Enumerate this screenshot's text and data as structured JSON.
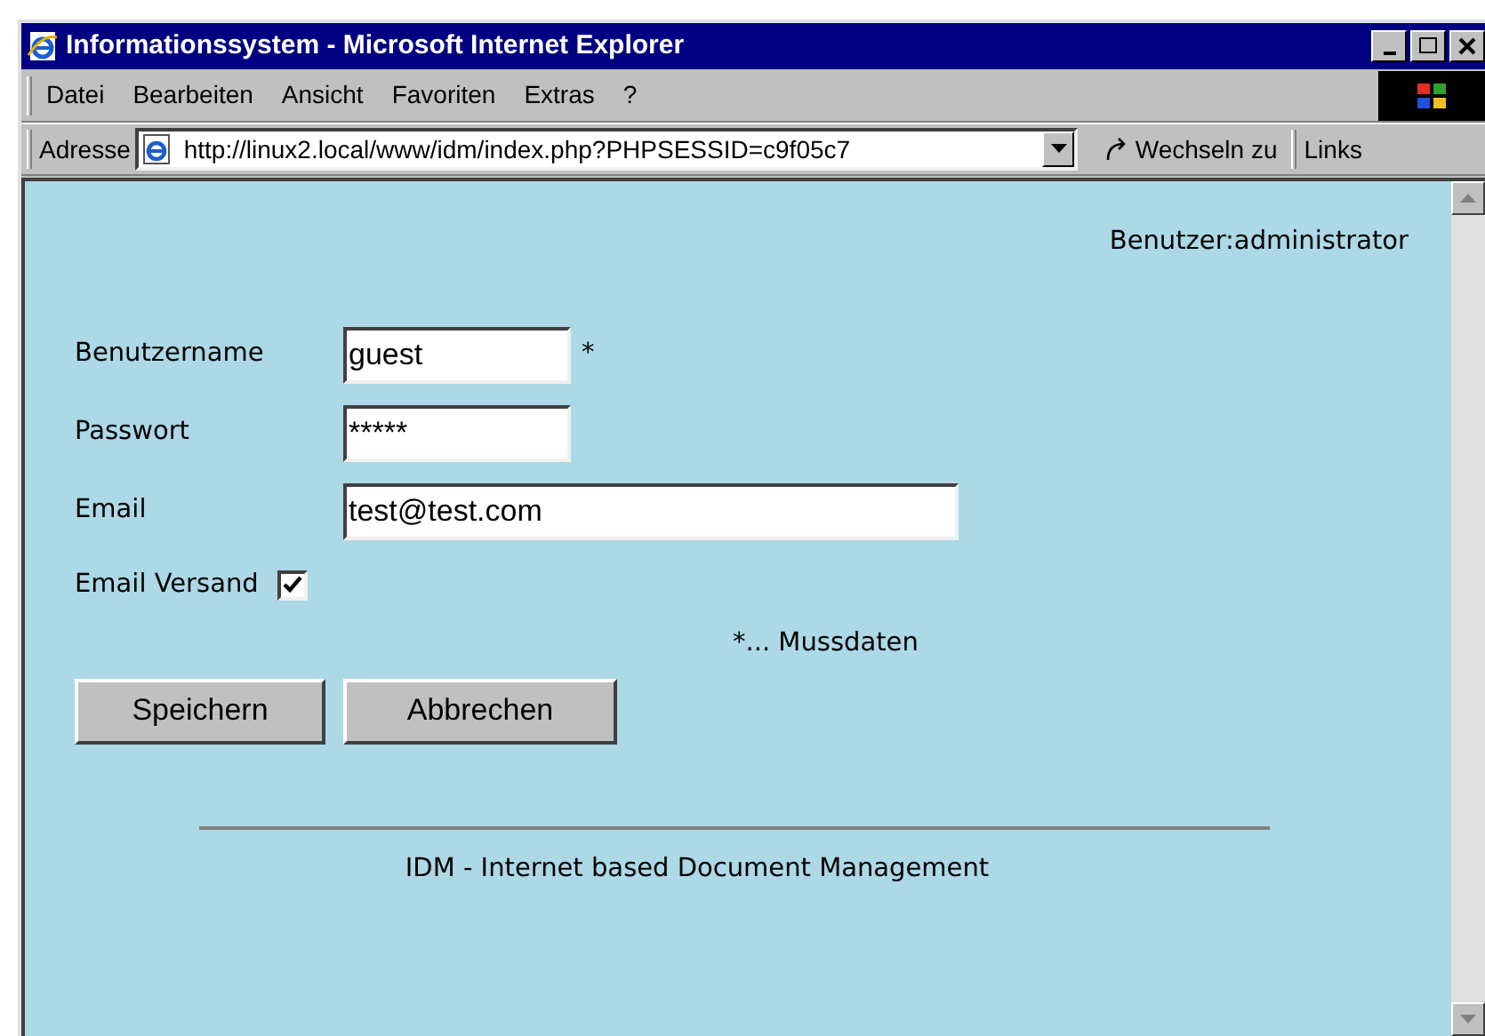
{
  "window": {
    "title": "Informationssystem - Microsoft Internet Explorer"
  },
  "menu": [
    {
      "label": "Datei"
    },
    {
      "label": "Bearbeiten"
    },
    {
      "label": "Ansicht"
    },
    {
      "label": "Favoriten"
    },
    {
      "label": "Extras"
    },
    {
      "label": "?"
    }
  ],
  "address_bar": {
    "label": "Adresse",
    "value": "http://linux2.local/www/idm/index.php?PHPSESSID=c9f05c7",
    "go_button": "Wechseln zu",
    "links": "Links"
  },
  "page": {
    "user": "Benutzer:administrator",
    "fields": [
      {
        "kind": "text",
        "label": "Benutzername",
        "value": "guest",
        "required_mark": "*",
        "wide": false
      },
      {
        "kind": "text",
        "label": "Passwort",
        "value": "*****",
        "wide": false
      },
      {
        "kind": "text",
        "label": "Email",
        "value": "test@test.com",
        "wide": true
      },
      {
        "kind": "checkbox",
        "label": "Email Versand",
        "checked": true
      }
    ],
    "required_note": "*... Mussdaten",
    "buttons": [
      "Speichern",
      "Abbrechen"
    ],
    "footer": "IDM - Internet based Document Management"
  }
}
